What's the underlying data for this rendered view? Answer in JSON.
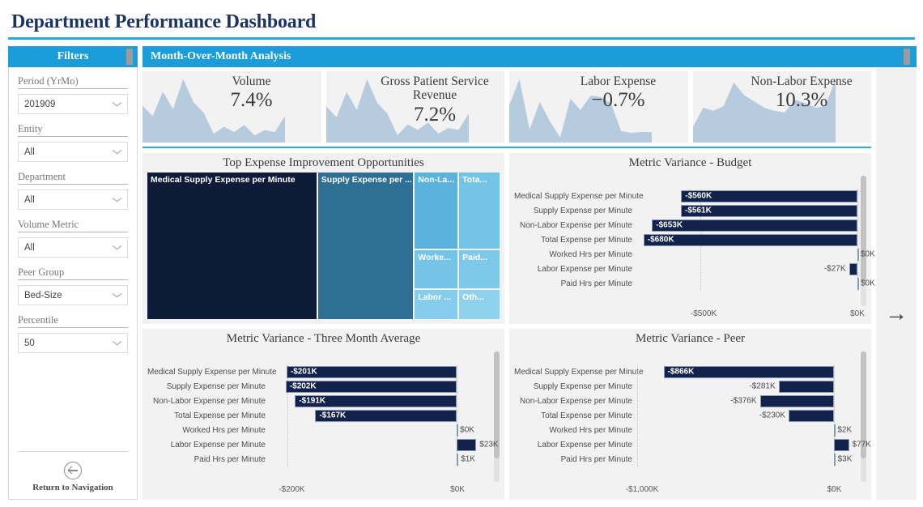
{
  "page": {
    "title": "Department Performance Dashboard",
    "accent_color": "#29a8de",
    "title_color": "#1c3461",
    "header_blue": "#1b9dd9",
    "bar_navy": "#13224a"
  },
  "filters": {
    "header": "Filters",
    "items": [
      {
        "label": "Period (YrMo)",
        "value": "201909",
        "icon": "chevron-down-icon"
      },
      {
        "label": "Entity",
        "value": "All",
        "icon": "chevron-down-icon"
      },
      {
        "label": "Department",
        "value": "All",
        "icon": "chevron-down-icon"
      },
      {
        "label": "Volume Metric",
        "value": "All",
        "icon": "chevron-down-icon"
      },
      {
        "label": "Peer Group",
        "value": "Bed-Size",
        "icon": "chevron-down-icon"
      },
      {
        "label": "Percentile",
        "value": "50",
        "icon": "chevron-down-icon"
      }
    ],
    "return_nav": {
      "label": "Return to Navigation",
      "icon": "circle-arrow-left-icon"
    }
  },
  "content": {
    "header": "Month-Over-Month Analysis",
    "next_page_arrow": "→"
  },
  "kpis": [
    {
      "title": "Volume",
      "value": "7.4%"
    },
    {
      "title": "Gross Patient Service Revenue",
      "value": "7.2%"
    },
    {
      "title": "Labor Expense",
      "value": "−0.7%"
    },
    {
      "title": "Non-Labor Expense",
      "value": "10.3%"
    }
  ],
  "treemap": {
    "title": "Top Expense Improvement Opportunities",
    "tiles": [
      {
        "label": "Medical Supply Expense per Minute",
        "color": "#0d1b38"
      },
      {
        "label": "Supply Expense per ...",
        "color": "#2e6f96"
      },
      {
        "label": "Non-La...",
        "color": "#5bb3dc"
      },
      {
        "label": "Tota...",
        "color": "#74c4e8"
      },
      {
        "label": "Worke...",
        "color": "#74c4e8"
      },
      {
        "label": "Paid...",
        "color": "#7ec9ea"
      },
      {
        "label": "Labor ...",
        "color": "#86cdec"
      },
      {
        "label": "Oth...",
        "color": "#8ed2ee"
      }
    ]
  },
  "chart_data": [
    {
      "type": "bar",
      "title": "Metric Variance - Budget",
      "orientation": "horizontal",
      "xlabel": "",
      "ylabel": "",
      "xlim": [
        -700,
        0
      ],
      "axis_ticks": [
        "-$500K",
        "$0K"
      ],
      "axis_tick_values": [
        -500,
        0
      ],
      "grid": true,
      "categories": [
        "Medical Supply Expense per Minute",
        "Supply Expense per Minute",
        "Non-Labor Expense per Minute",
        "Total Expense per Minute",
        "Worked Hrs per Minute",
        "Labor Expense per Minute",
        "Paid Hrs per Minute"
      ],
      "values": [
        -560,
        -561,
        -653,
        -680,
        0,
        -27,
        0
      ],
      "labels": [
        "-$560K",
        "-$561K",
        "-$653K",
        "-$680K",
        "$0K",
        "-$27K",
        "$0K"
      ]
    },
    {
      "type": "bar",
      "title": "Metric Variance - Three Month Average",
      "orientation": "horizontal",
      "xlabel": "",
      "ylabel": "",
      "xlim": [
        -220,
        40
      ],
      "axis_ticks": [
        "-$200K",
        "$0K"
      ],
      "axis_tick_values": [
        -200,
        0
      ],
      "grid": true,
      "categories": [
        "Medical Supply Expense per Minute",
        "Supply Expense per Minute",
        "Non-Labor Expense per Minute",
        "Total Expense per Minute",
        "Worked Hrs per Minute",
        "Labor Expense per Minute",
        "Paid Hrs per Minute"
      ],
      "values": [
        -201,
        -202,
        -191,
        -167,
        0,
        23,
        1
      ],
      "labels": [
        "-$201K",
        "-$202K",
        "-$191K",
        "-$167K",
        "$0K",
        "$23K",
        "$1K"
      ]
    },
    {
      "type": "bar",
      "title": "Metric Variance - Peer",
      "orientation": "horizontal",
      "xlabel": "",
      "ylabel": "",
      "xlim": [
        -1000,
        120
      ],
      "axis_ticks": [
        "-$1,000K",
        "$0K"
      ],
      "axis_tick_values": [
        -1000,
        0
      ],
      "grid": true,
      "categories": [
        "Medical Supply Expense per Minute",
        "Supply Expense per Minute",
        "Non-Labor Expense per Minute",
        "Total Expense per Minute",
        "Worked Hrs per Minute",
        "Labor Expense per Minute",
        "Paid Hrs per Minute"
      ],
      "values": [
        -866,
        -281,
        -376,
        -230,
        2,
        77,
        3
      ],
      "labels": [
        "-$866K",
        "-$281K",
        "-$376K",
        "-$230K",
        "$2K",
        "$77K",
        "$3K"
      ]
    }
  ],
  "sparklines": {
    "volume": [
      42,
      30,
      58,
      38,
      72,
      46,
      34,
      10,
      18,
      12,
      20,
      8,
      14,
      12,
      30
    ],
    "revenue": [
      40,
      28,
      56,
      36,
      70,
      44,
      32,
      8,
      20,
      14,
      22,
      10,
      16,
      14,
      32
    ],
    "labor": [
      46,
      78,
      16,
      50,
      26,
      6,
      54,
      40,
      58,
      56,
      48,
      14,
      12,
      13,
      13
    ],
    "nonlabor": [
      20,
      44,
      40,
      46,
      76,
      60,
      52,
      44,
      40,
      38,
      54,
      50,
      44,
      46,
      80
    ]
  }
}
